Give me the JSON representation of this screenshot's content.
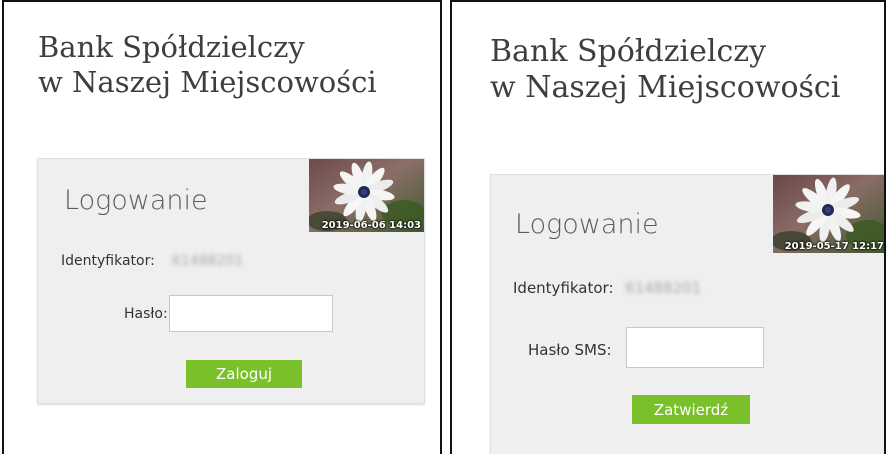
{
  "colors": {
    "button_green": "#79c02a",
    "card_bg": "#efefef",
    "border": "#111111"
  },
  "left": {
    "bank_name_line1": "Bank Spółdzielczy",
    "bank_name_line2": "w Naszej Miejscowości",
    "title": "Logowanie",
    "photo_timestamp": "2019-06-06 14:03",
    "identifier_label": "Identyfikator:",
    "identifier_value": "61488201",
    "password_label": "Hasło:",
    "password_value": "",
    "submit_label": "Zaloguj"
  },
  "right": {
    "bank_name_line1": "Bank Spółdzielczy",
    "bank_name_line2": "w Naszej Miejscowości",
    "title": "Logowanie",
    "photo_timestamp": "2019-05-17 12:17",
    "identifier_label": "Identyfikator:",
    "identifier_value": "61488201",
    "sms_label": "Hasło SMS:",
    "sms_value": "",
    "submit_label": "Zatwierdź"
  }
}
